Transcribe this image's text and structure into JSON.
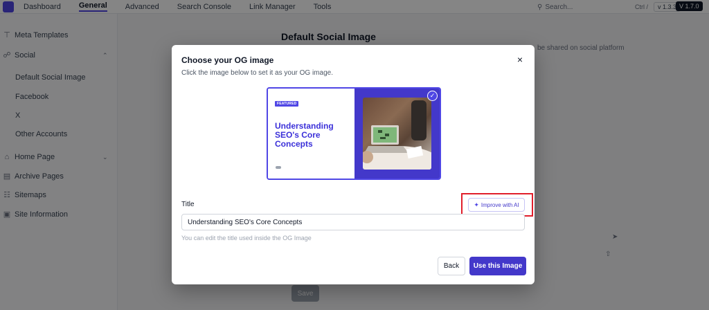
{
  "topnav": {
    "items": [
      "Dashboard",
      "General",
      "Advanced",
      "Search Console",
      "Link Manager",
      "Tools"
    ],
    "search_placeholder": "Search...",
    "search_shortcut": "Ctrl /",
    "version_a": "v 1.3.3",
    "version_b": "V 1.7.0"
  },
  "sidebar": {
    "items": [
      {
        "label": "Meta Templates",
        "icon": "template-icon"
      },
      {
        "label": "Social",
        "icon": "share-icon"
      },
      {
        "label": "Default Social Image"
      },
      {
        "label": "Facebook"
      },
      {
        "label": "X"
      },
      {
        "label": "Other Accounts"
      },
      {
        "label": "Home Page",
        "icon": "home-icon"
      },
      {
        "label": "Archive Pages",
        "icon": "archive-icon"
      },
      {
        "label": "Sitemaps",
        "icon": "sitemap-icon"
      },
      {
        "label": "Site Information",
        "icon": "info-icon"
      }
    ]
  },
  "main": {
    "heading": "Default Social Image",
    "note": "be shared on social platform",
    "save_label": "Save"
  },
  "modal": {
    "title": "Choose your OG image",
    "subtitle": "Click the image below to set it as your OG image.",
    "og_image": {
      "tag": "FEATURED",
      "headline": "Understanding SEO's Core Concepts",
      "selected": true
    },
    "field_label": "Title",
    "improve_label": "Improve with AI",
    "title_value": "Understanding SEO's Core Concepts",
    "help_text": "You can edit the title used inside the OG Image",
    "back_label": "Back",
    "use_label": "Use this Image"
  },
  "colors": {
    "accent": "#4f46e5",
    "accent_dark": "#4338ca",
    "highlight_box": "#e11d2a"
  }
}
